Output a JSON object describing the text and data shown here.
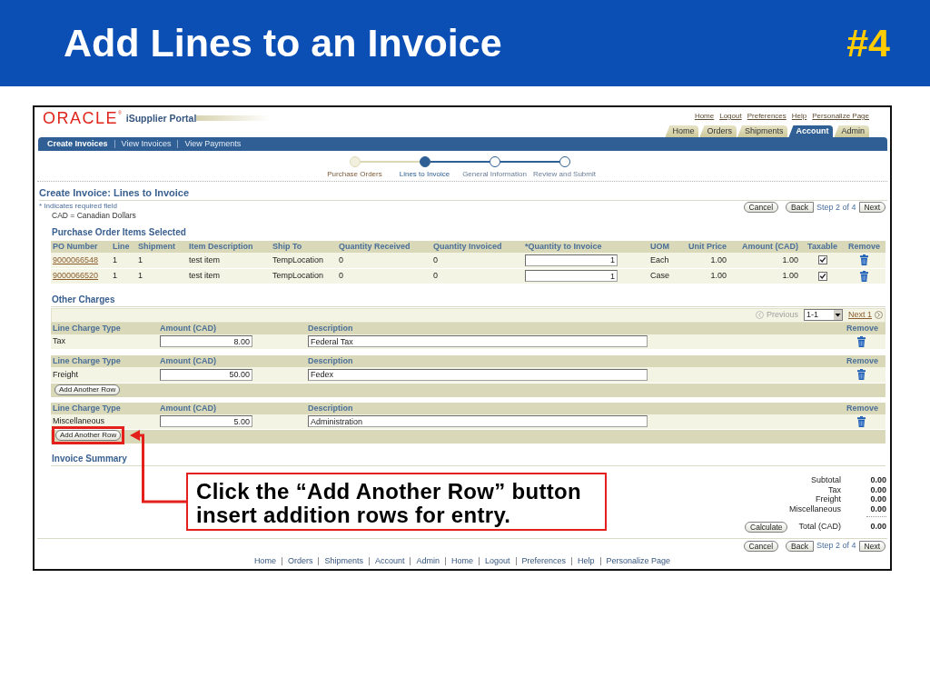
{
  "slide": {
    "title": "Add Lines to an Invoice",
    "number": "#4"
  },
  "portal": {
    "logo": "ORACLE$^{®}$",
    "product": "iSupplier Portal",
    "global_links": [
      "Home",
      "Logout",
      "Preferences",
      "Help",
      "Personalize Page"
    ],
    "tabs": [
      {
        "label": "Home",
        "selected": false
      },
      {
        "label": "Orders",
        "selected": false
      },
      {
        "label": "Shipments",
        "selected": false
      },
      {
        "label": "Account",
        "selected": true
      },
      {
        "label": "Admin",
        "selected": false
      }
    ],
    "subtabs": [
      {
        "label": "Create Invoices",
        "selected": true
      },
      {
        "label": "View Invoices",
        "selected": false
      },
      {
        "label": "View Payments",
        "selected": false
      }
    ],
    "train": [
      {
        "label": "Purchase Orders",
        "visited": true,
        "selected": false
      },
      {
        "label": "Lines to Invoice",
        "visited": false,
        "selected": true
      },
      {
        "label": "General Information",
        "visited": false,
        "selected": false
      },
      {
        "label": "Review and Submit",
        "visited": false,
        "selected": false
      }
    ]
  },
  "page": {
    "title": "Create Invoice: Lines to Invoice",
    "required_note": "* Indicates required field",
    "currency_note": "CAD = Canadian Dollars",
    "top_navigation": {
      "cancel": "Cancel",
      "back": "Back",
      "step": "Step 2 of 4",
      "next": "Next"
    }
  },
  "po_items": {
    "title": "Purchase Order Items Selected",
    "columns": [
      "PO Number",
      "Line",
      "Shipment",
      "Item Description",
      "Ship To",
      "Quantity Received",
      "Quantity Invoiced",
      "*Quantity to Invoice",
      "UOM",
      "Unit Price",
      "Amount (CAD)",
      "Taxable",
      "Remove"
    ],
    "rows": [
      {
        "po_number": "9000066548",
        "line": "1",
        "shipment": "1",
        "item_description": "test item",
        "ship_to": "TempLocation",
        "quantity_received": "0",
        "quantity_invoiced": "0",
        "quantity_to_invoice": "1",
        "uom": "Each",
        "unit_price": "1.00",
        "amount": "1.00",
        "taxable": true
      },
      {
        "po_number": "9000066520",
        "line": "1",
        "shipment": "1",
        "item_description": "test item",
        "ship_to": "TempLocation",
        "quantity_received": "0",
        "quantity_invoiced": "0",
        "quantity_to_invoice": "1",
        "uom": "Case",
        "unit_price": "1.00",
        "amount": "1.00",
        "taxable": true
      }
    ]
  },
  "other_charges": {
    "title": "Other Charges",
    "pager": {
      "previous": {
        "label": "Previous",
        "disabled": true
      },
      "range": "1-1",
      "next": {
        "label": "Next 1",
        "disabled": false
      }
    },
    "blocks": [
      {
        "columns": [
          "Line Charge Type",
          "Amount (CAD)",
          "Description",
          "Remove"
        ],
        "charge_type": "Tax",
        "amount": "8.00",
        "description": "Federal Tax"
      },
      {
        "columns": [
          "Line Charge Type",
          "Amount (CAD)",
          "Description",
          "Remove"
        ],
        "charge_type": "Freight",
        "amount": "50.00",
        "description": "Fedex",
        "add_row": {
          "label": "Add Another Row",
          "highlighted": false
        }
      },
      {
        "columns": [
          "Line Charge Type",
          "Amount (CAD)",
          "Description",
          "Remove"
        ],
        "charge_type": "Miscellaneous",
        "amount": "5.00",
        "description": "Administration",
        "add_row": {
          "label": "Add Another Row",
          "highlighted": true
        }
      }
    ]
  },
  "summary": {
    "title": "Invoice Summary",
    "lines": [
      {
        "label": "Subtotal",
        "value": "0.00"
      },
      {
        "label": "Tax",
        "value": "0.00"
      },
      {
        "label": "Freight",
        "value": "0.00"
      },
      {
        "label": "Miscellaneous",
        "value": "0.00"
      }
    ],
    "calculate": "Calculate",
    "total_label": "Total (CAD)",
    "total": "0.00"
  },
  "bottom_navigation": {
    "cancel": "Cancel",
    "back": "Back",
    "step": "Step 2 of 4",
    "next": "Next"
  },
  "footer_links": [
    "Home",
    "Orders",
    "Shipments",
    "Account",
    "Admin",
    "Home",
    "Logout",
    "Preferences",
    "Help",
    "Personalize Page"
  ],
  "callout": {
    "text": "Click the “Add Another Row” button insert addition rows for entry."
  }
}
